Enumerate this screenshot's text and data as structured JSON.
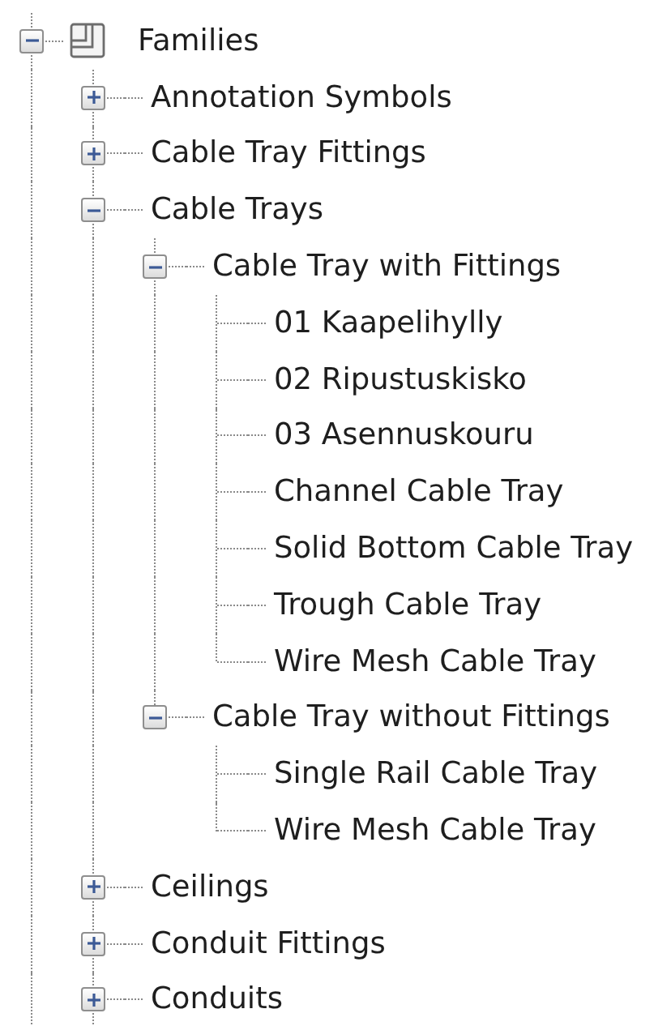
{
  "tree": [
    {
      "label": "Families",
      "expanded": true,
      "children": [
        {
          "label": "Annotation Symbols",
          "expanded": false
        },
        {
          "label": "Cable Tray Fittings",
          "expanded": false
        },
        {
          "label": "Cable Trays",
          "expanded": true,
          "children": [
            {
              "label": "Cable Tray with Fittings",
              "expanded": true,
              "children": [
                {
                  "label": "01 Kaapelihylly"
                },
                {
                  "label": "02 Ripustuskisko"
                },
                {
                  "label": "03 Asennuskouru"
                },
                {
                  "label": "Channel Cable Tray"
                },
                {
                  "label": "Solid Bottom Cable Tray"
                },
                {
                  "label": "Trough Cable Tray"
                },
                {
                  "label": "Wire Mesh Cable Tray"
                }
              ]
            },
            {
              "label": "Cable Tray without Fittings",
              "expanded": true,
              "children": [
                {
                  "label": "Single Rail Cable Tray"
                },
                {
                  "label": "Wire Mesh Cable Tray"
                }
              ]
            }
          ]
        },
        {
          "label": "Ceilings",
          "expanded": false
        },
        {
          "label": "Conduit Fittings",
          "expanded": false
        },
        {
          "label": "Conduits",
          "expanded": false
        }
      ]
    }
  ]
}
